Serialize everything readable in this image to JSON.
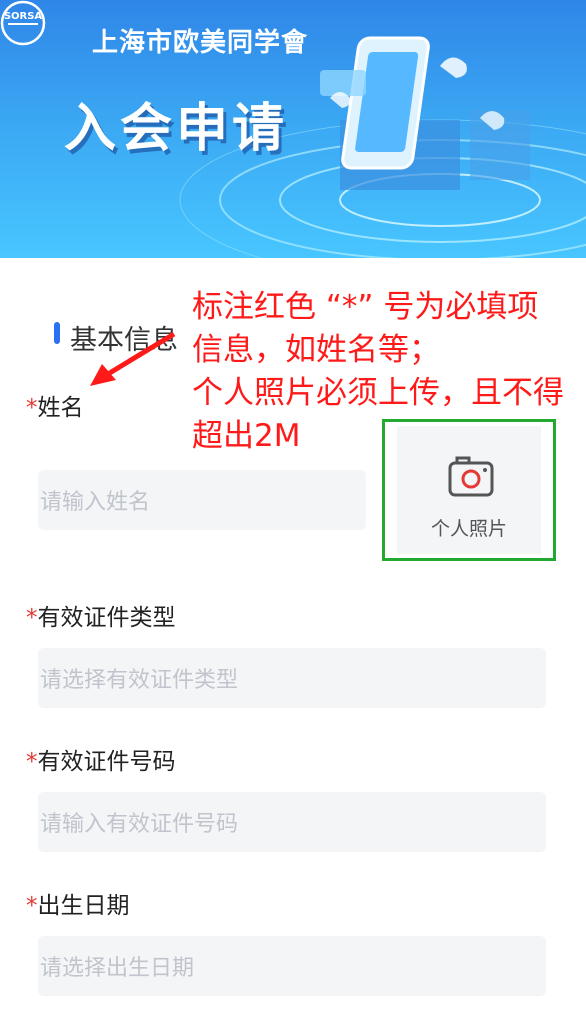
{
  "banner": {
    "society_name": "上海市欧美同学會",
    "title": "入会申请",
    "logo_text": "SORSA"
  },
  "section": {
    "title": "基本信息"
  },
  "fields": [
    {
      "required_mark": "*",
      "label": "姓名",
      "placeholder": "请输入姓名"
    },
    {
      "required_mark": "*",
      "label": "有效证件类型",
      "placeholder": "请选择有效证件类型"
    },
    {
      "required_mark": "*",
      "label": "有效证件号码",
      "placeholder": "请输入有效证件号码"
    },
    {
      "required_mark": "*",
      "label": "出生日期",
      "placeholder": "请选择出生日期"
    }
  ],
  "photo": {
    "label": "个人照片",
    "icon": "camera-icon"
  },
  "annotation": {
    "lines": [
      "标注红色 “*” 号为必填项",
      "信息，如姓名等；",
      "个人照片必须上传，且不得",
      "超出2M"
    ],
    "color": "#ff1a1a"
  },
  "colors": {
    "accent": "#2d6ff2",
    "required": "#e53935",
    "highlight_border": "#22aa30"
  }
}
